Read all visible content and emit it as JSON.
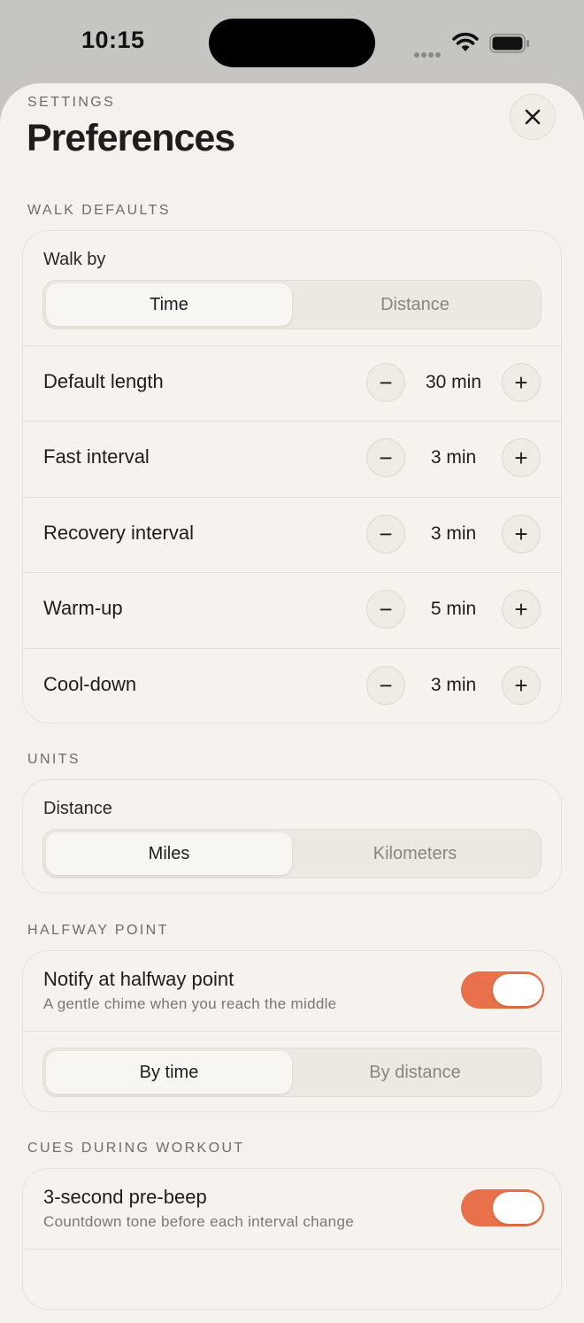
{
  "status_bar": {
    "time": "10:15"
  },
  "header": {
    "eyebrow": "SETTINGS",
    "title": "Preferences"
  },
  "walk_defaults": {
    "section_label": "WALK DEFAULTS",
    "walk_by_label": "Walk by",
    "walk_by_options": [
      "Time",
      "Distance"
    ],
    "walk_by_selected": "Time",
    "rows": [
      {
        "label": "Default length",
        "value": "30 min"
      },
      {
        "label": "Fast interval",
        "value": "3 min"
      },
      {
        "label": "Recovery interval",
        "value": "3 min"
      },
      {
        "label": "Warm-up",
        "value": "5 min"
      },
      {
        "label": "Cool-down",
        "value": "3 min"
      }
    ]
  },
  "units": {
    "section_label": "UNITS",
    "distance_label": "Distance",
    "options": [
      "Miles",
      "Kilometers"
    ],
    "selected": "Miles"
  },
  "halfway": {
    "section_label": "HALFWAY POINT",
    "toggle_title": "Notify at halfway point",
    "toggle_subtitle": "A gentle chime when you reach the middle",
    "toggle_on": true,
    "options": [
      "By time",
      "By distance"
    ],
    "selected": "By time"
  },
  "cues": {
    "section_label": "CUES DURING WORKOUT",
    "toggle_title": "3-second pre-beep",
    "toggle_subtitle": "Countdown tone before each interval change",
    "toggle_on": true
  },
  "icons": {
    "close": "close-icon",
    "minus": "minus-icon",
    "plus": "plus-icon",
    "wifi": "wifi-icon",
    "battery": "battery-icon",
    "signal": "signal-icon"
  },
  "colors": {
    "accent": "#e8704a",
    "background": "#f5f2ed"
  }
}
